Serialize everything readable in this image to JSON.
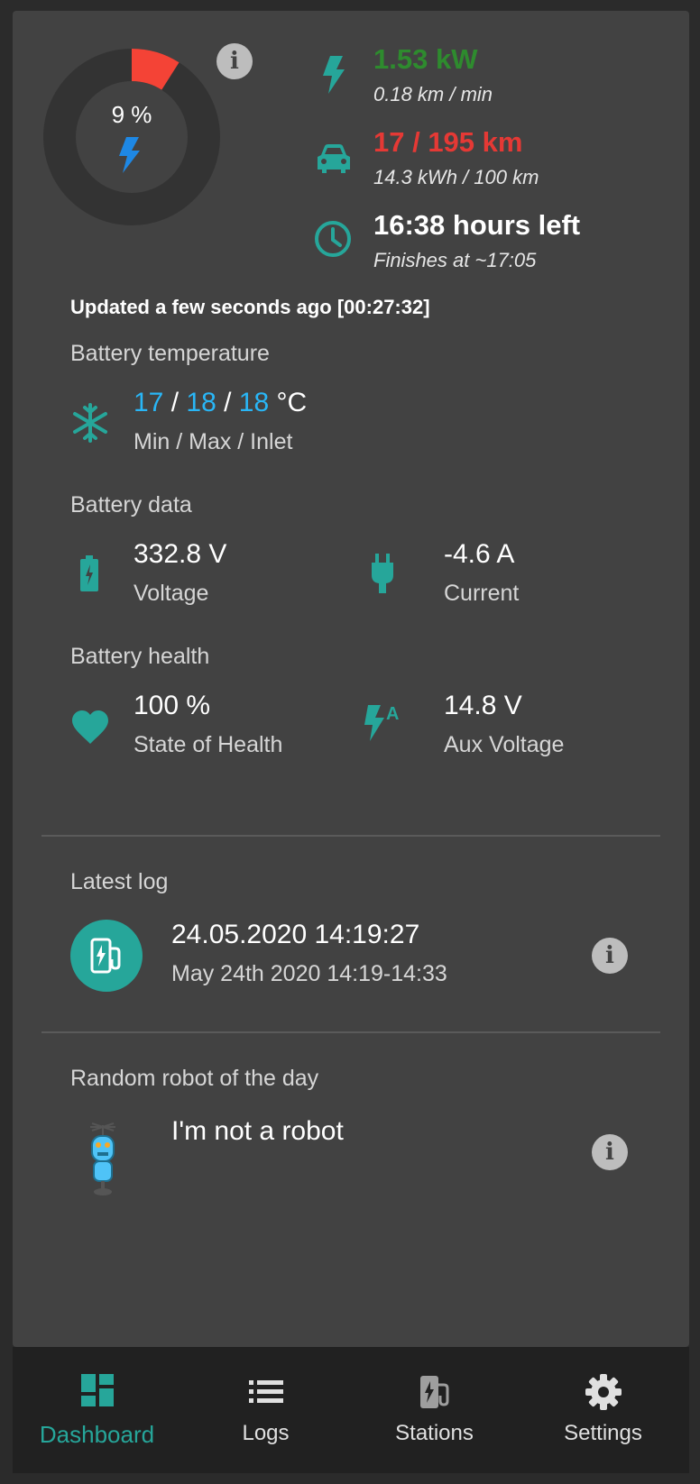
{
  "gauge": {
    "percent_text": "9 %",
    "fraction": 0.09,
    "fill_color": "#f44336"
  },
  "stats": {
    "power": "1.53 kW",
    "speed": "0.18 km / min",
    "range": "17 / 195 km",
    "consumption": "14.3 kWh / 100 km",
    "time_left": "16:38 hours left",
    "finish": "Finishes at ~17:05"
  },
  "updated": "Updated a few seconds ago [00:27:32]",
  "temperature": {
    "title": "Battery temperature",
    "min": "17",
    "max": "18",
    "inlet": "18",
    "sep": " / ",
    "unit": " °C",
    "label": "Min / Max / Inlet"
  },
  "battery_data": {
    "title": "Battery data",
    "voltage": "332.8 V",
    "voltage_label": "Voltage",
    "current": "-4.6 A",
    "current_label": "Current"
  },
  "battery_health": {
    "title": "Battery health",
    "soh": "100 %",
    "soh_label": "State of Health",
    "aux": "14.8 V",
    "aux_label": "Aux Voltage"
  },
  "latest_log": {
    "title": "Latest log",
    "date": "24.05.2020 14:19:27",
    "range": "May 24th 2020 14:19-14:33"
  },
  "robot": {
    "title": "Random robot of the day",
    "text": "I'm not a robot"
  },
  "nav": {
    "dashboard": "Dashboard",
    "logs": "Logs",
    "stations": "Stations",
    "settings": "Settings"
  },
  "icons": {
    "bolt": "bolt-icon",
    "car": "car-icon",
    "clock": "clock-icon",
    "snowflake": "snowflake-icon",
    "battery": "battery-icon",
    "plug": "plug-icon",
    "heart": "heart-icon",
    "aux": "aux-bolt-icon",
    "info": "info-icon",
    "charging-station": "charging-station-icon",
    "robot": "robot-icon"
  },
  "colors": {
    "accent": "#26a69a",
    "background": "#424242",
    "nav_background": "#212121"
  }
}
